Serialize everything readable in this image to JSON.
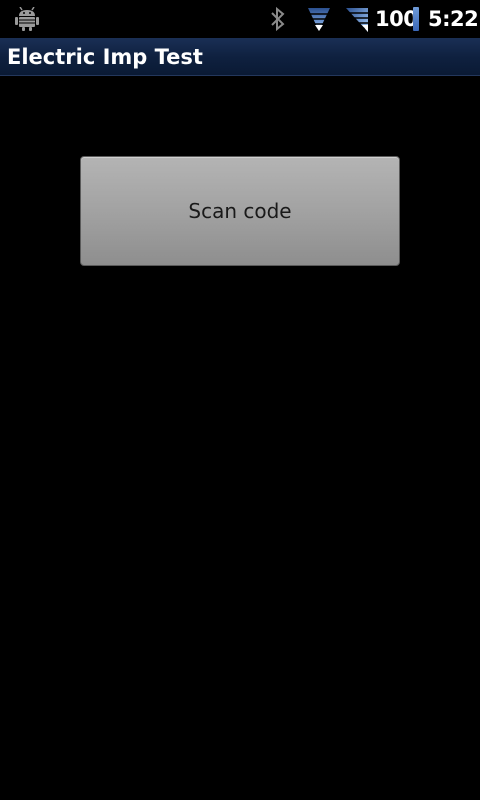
{
  "status_bar": {
    "icons": {
      "notification": "android-debug-icon",
      "bluetooth": "bluetooth-icon",
      "wifi": "wifi-icon",
      "signal": "signal-icon",
      "battery": "battery-icon"
    },
    "battery_level": "100",
    "time": "5:22"
  },
  "app": {
    "title": "Electric Imp Test"
  },
  "main": {
    "scan_button_label": "Scan code"
  },
  "colors": {
    "accent": "#3a67b8",
    "title_bar": "#0f2140",
    "button": "#a2a2a2",
    "background": "#000000"
  }
}
